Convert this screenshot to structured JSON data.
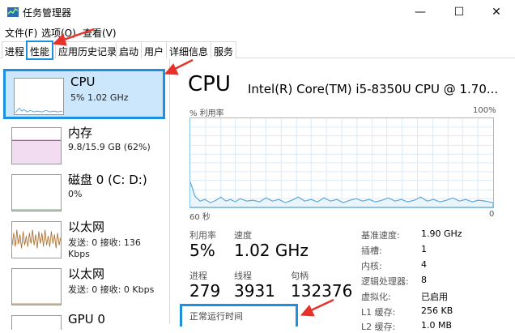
{
  "window": {
    "title": "任务管理器",
    "minimize": "—",
    "maximize": "☐",
    "close": "✕"
  },
  "menu": {
    "file": "文件(F)",
    "options": "选项(O)",
    "view": "查看(V)"
  },
  "tabs": [
    "进程",
    "性能",
    "应用历史记录",
    "启动",
    "用户",
    "详细信息",
    "服务"
  ],
  "sidebar": {
    "items": [
      {
        "title": "CPU",
        "sub": "5%  1.02 GHz"
      },
      {
        "title": "内存",
        "sub": "9.8/15.9 GB (62%)"
      },
      {
        "title": "磁盘 0 (C: D:)",
        "sub": "0%"
      },
      {
        "title": "以太网",
        "sub": "发送: 0 接收: 136 Kbps"
      },
      {
        "title": "以太网",
        "sub": "发送: 0 接收: 0 Kbps"
      },
      {
        "title": "GPU 0",
        "sub": ""
      }
    ]
  },
  "main": {
    "title": "CPU",
    "model": "Intel(R) Core(TM) i5-8350U CPU @ 1.70...",
    "graph_label": "% 利用率",
    "graph_max": "100%",
    "graph_time": "60 秒",
    "graph_min": "0",
    "utilization_label": "利用率",
    "utilization_value": "5%",
    "speed_label": "速度",
    "speed_value": "1.02 GHz",
    "processes_label": "进程",
    "processes_value": "279",
    "threads_label": "线程",
    "threads_value": "3931",
    "handles_label": "句柄",
    "handles_value": "132376",
    "uptime_label": "正常运行时间",
    "specs": [
      {
        "key": "基准速度:",
        "value": "1.90 GHz"
      },
      {
        "key": "插槽:",
        "value": "1"
      },
      {
        "key": "内核:",
        "value": "4"
      },
      {
        "key": "逻辑处理器:",
        "value": "8"
      },
      {
        "key": "虚拟化:",
        "value": "已启用"
      },
      {
        "key": "L1 缓存:",
        "value": "256 KB"
      },
      {
        "key": "L2 缓存:",
        "value": "1.0 MB"
      }
    ]
  },
  "colors": {
    "accent": "#1e90e0",
    "arrow": "#e8312a",
    "graph_line": "#5aa9dc",
    "selected_bg": "#cce6fb"
  }
}
